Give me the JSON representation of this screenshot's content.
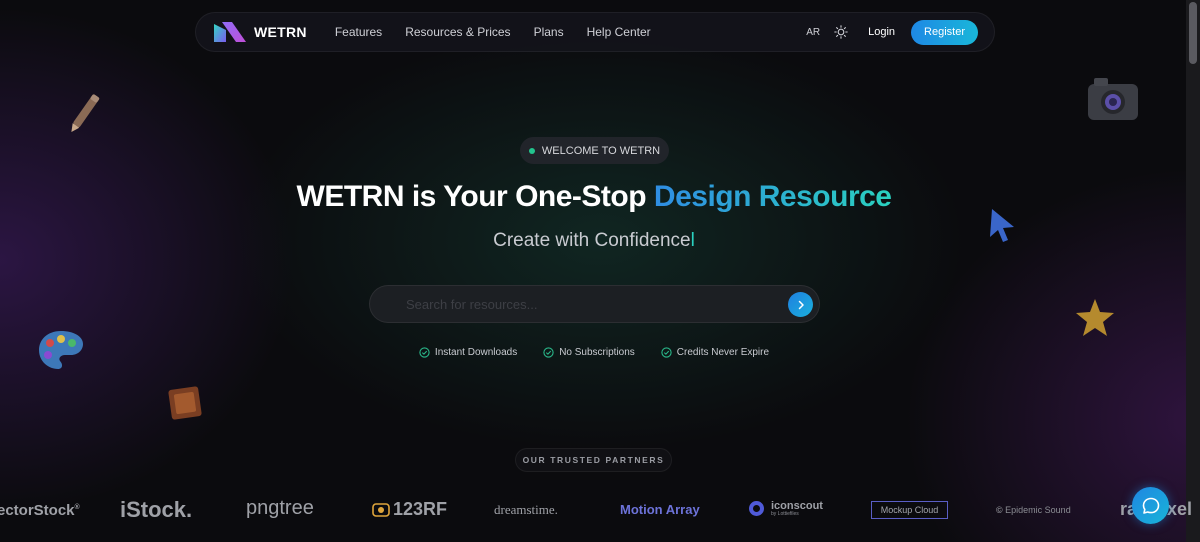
{
  "brand": {
    "name": "WETRN"
  },
  "nav": {
    "links": [
      "Features",
      "Resources & Prices",
      "Plans",
      "Help Center"
    ],
    "lang": "AR",
    "theme_icon": "sun-icon",
    "login": "Login",
    "register": "Register"
  },
  "hero": {
    "badge": "WELCOME TO WETRN",
    "title_plain": "WETRN is Your One-Stop ",
    "title_highlight": "Design Resource",
    "subtitle": "Create with Confidence",
    "caret": "l",
    "search_placeholder": "Search for resources...",
    "features": [
      "Instant Downloads",
      "No Subscriptions",
      "Credits Never Expire"
    ]
  },
  "partners": {
    "label": "OUR TRUSTED PARTNERS",
    "logos": {
      "vectorstock": "ectorStock",
      "vectorstock_mark": "®",
      "istock": "iStock.",
      "pngtree": "pngtree",
      "rf": "123RF",
      "dreamstime": "dreamstime.",
      "motionarray": "Motion Array",
      "iconscout": "iconscout",
      "iconscout_by": "by Lottiefiles",
      "mockupcloud": "Mockup Cloud",
      "epidemic": "Epidemic Sound",
      "rawpixel": "rawpixel"
    }
  },
  "colors": {
    "accent_blue": "#1e88e5",
    "accent_teal": "#2ad1bf",
    "badge_dot": "#22c48d",
    "check": "#2ab88a"
  }
}
